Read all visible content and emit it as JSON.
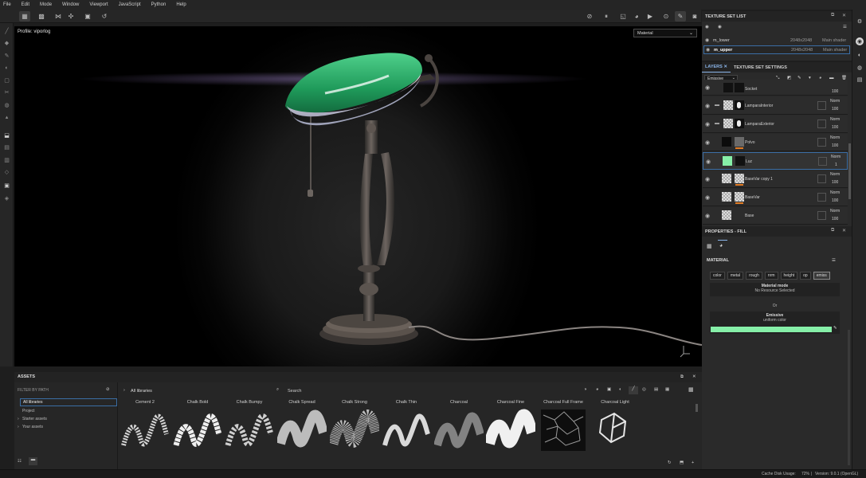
{
  "menu": [
    "File",
    "Edit",
    "Mode",
    "Window",
    "Viewport",
    "JavaScript",
    "Python",
    "Help"
  ],
  "viewport": {
    "profile": "Profile: viporlog",
    "material_mode": "Material"
  },
  "texture_set_list": {
    "title": "TEXTURE SET LIST",
    "rows": [
      {
        "name": "m_lower",
        "resolution": "2048x2048",
        "shader": "Main shader"
      },
      {
        "name": "m_upper",
        "resolution": "2048x2048",
        "shader": "Main shader"
      }
    ]
  },
  "tabs": {
    "layers": "LAYERS",
    "settings": "TEXTURE SET SETTINGS"
  },
  "layers": {
    "channel": "Emissive",
    "rows": [
      {
        "name": "Socket",
        "blend": "",
        "opacity": "100"
      },
      {
        "name": "LamparaInterior",
        "blend": "Norm",
        "opacity": "100"
      },
      {
        "name": "LamparaExterior",
        "blend": "Norm",
        "opacity": "100"
      },
      {
        "name": "Polvo",
        "blend": "Norm",
        "opacity": "100"
      },
      {
        "name": "Luz",
        "blend": "Norm",
        "opacity": "1"
      },
      {
        "name": "BaseVar copy 1",
        "blend": "Norm",
        "opacity": "100"
      },
      {
        "name": "BaseVar",
        "blend": "Norm",
        "opacity": "100"
      },
      {
        "name": "Base",
        "blend": "Norm",
        "opacity": "100"
      }
    ]
  },
  "properties": {
    "title": "PROPERTIES - FILL",
    "material_label": "MATERIAL",
    "channels": [
      "color",
      "metal",
      "rough",
      "nrm",
      "height",
      "op",
      "emiss"
    ],
    "material_mode_label": "Material mode",
    "material_mode_value": "No Resource Selected",
    "or_label": "Or",
    "emissive_label": "Emissive",
    "emissive_value": "uniform color",
    "emissive_color": "#86efa8"
  },
  "assets": {
    "title": "ASSETS",
    "filter_label": "FILTER BY PATH",
    "libraries": [
      "All libraries",
      "Project",
      "Starter assets",
      "Your assets"
    ],
    "breadcrumb": "All libraries",
    "search_placeholder": "Search",
    "brushes": [
      "Cement 2",
      "Chalk Bold",
      "Chalk Bumpy",
      "Chalk Spread",
      "Chalk Strong",
      "Chalk Thin",
      "Charcoal",
      "Charcoal Fine",
      "Charcoal Full Frame",
      "Charcoal Light"
    ]
  },
  "status": {
    "cache_label": "Cache Disk Usage:",
    "cache_value": "72%",
    "version": "Version: 9.0.1 (OpenGL)"
  },
  "colors": {
    "accent": "#3b6ea5",
    "lamp_shade": "#2fa86a",
    "orange": "#e07b25"
  }
}
